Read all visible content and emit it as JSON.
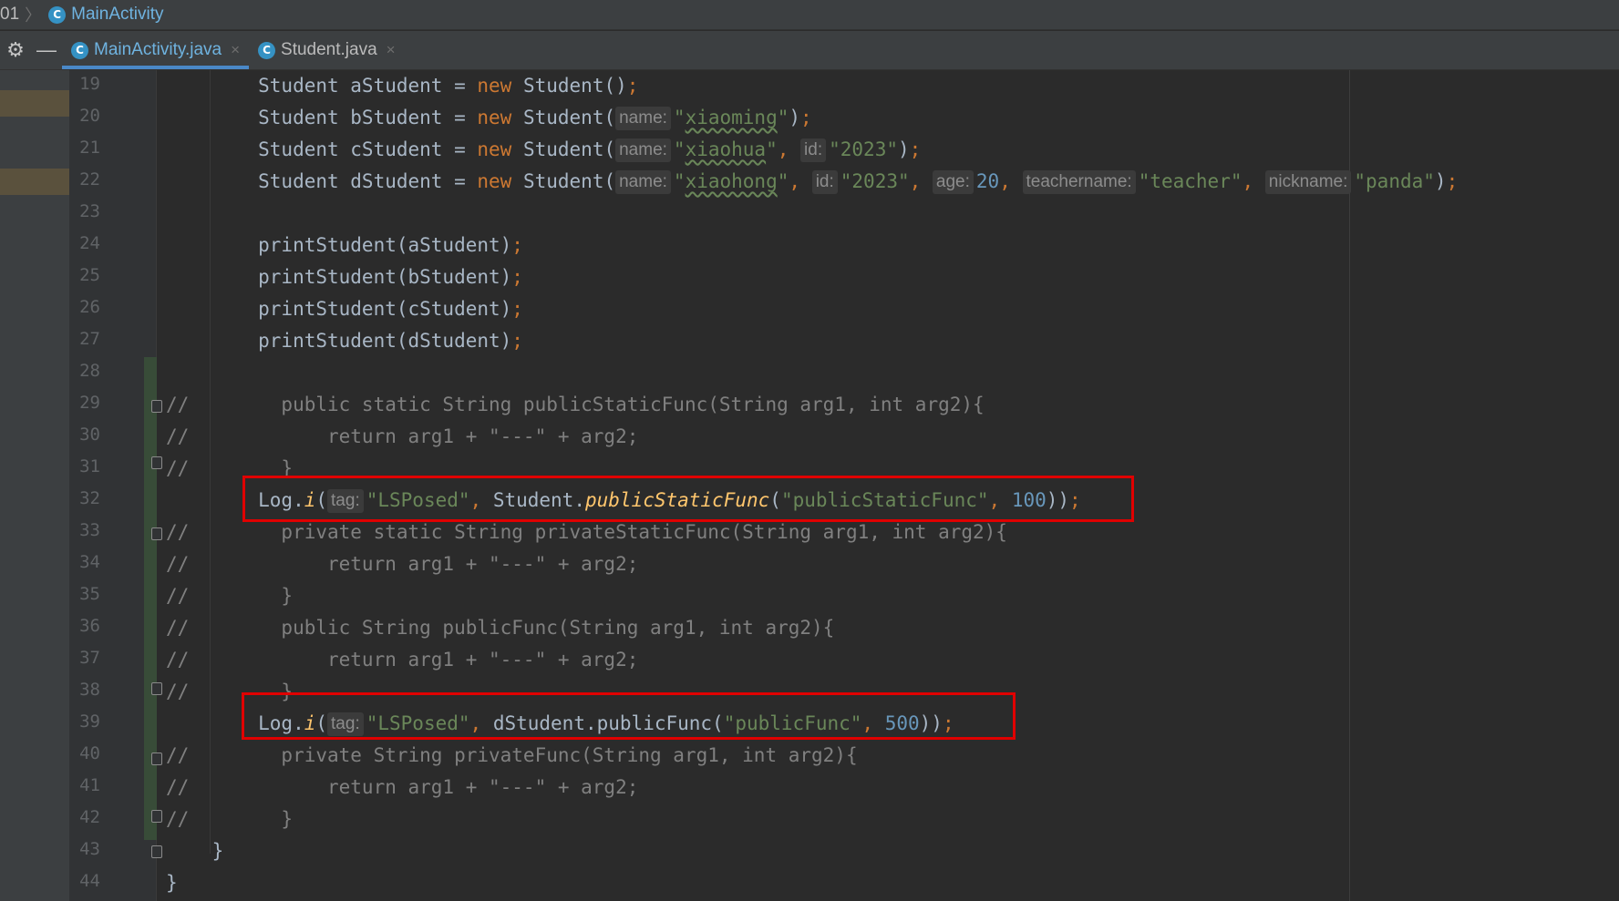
{
  "breadcrumb": {
    "prev": "01",
    "current": "MainActivity",
    "class_badge": "C"
  },
  "toolbar": {
    "settings_icon": "gear-icon",
    "minimize_icon": "minus-icon"
  },
  "tabs": [
    {
      "label": "MainActivity.java",
      "active": true
    },
    {
      "label": "Student.java",
      "active": false
    }
  ],
  "tab_close": "×",
  "colors": {
    "keyword": "#cc7832",
    "string": "#6a8759",
    "number": "#6897bb",
    "comment": "#808080",
    "highlight_box": "#e00000"
  },
  "lines": [
    {
      "n": "19",
      "segs": [
        [
          "plain",
          "        Student aStudent = "
        ],
        [
          "kw",
          "new"
        ],
        [
          "plain",
          " Student()"
        ],
        [
          "kw",
          ";"
        ]
      ]
    },
    {
      "n": "20",
      "segs": [
        [
          "plain",
          "        Student bStudent = "
        ],
        [
          "kw",
          "new"
        ],
        [
          "plain",
          " Student("
        ],
        [
          "hint",
          "name:"
        ],
        [
          "str",
          "\""
        ],
        [
          "typo",
          "xiaoming"
        ],
        [
          "str",
          "\""
        ],
        [
          "plain",
          ")"
        ],
        [
          "kw",
          ";"
        ]
      ]
    },
    {
      "n": "21",
      "segs": [
        [
          "plain",
          "        Student cStudent = "
        ],
        [
          "kw",
          "new"
        ],
        [
          "plain",
          " Student("
        ],
        [
          "hint",
          "name:"
        ],
        [
          "str",
          "\""
        ],
        [
          "typo",
          "xiaohua"
        ],
        [
          "str",
          "\""
        ],
        [
          "kw",
          ", "
        ],
        [
          "hint",
          "id:"
        ],
        [
          "str",
          "\"2023\""
        ],
        [
          "plain",
          ")"
        ],
        [
          "kw",
          ";"
        ]
      ]
    },
    {
      "n": "22",
      "segs": [
        [
          "plain",
          "        Student dStudent = "
        ],
        [
          "kw",
          "new"
        ],
        [
          "plain",
          " Student("
        ],
        [
          "hint",
          "name:"
        ],
        [
          "str",
          "\""
        ],
        [
          "typo",
          "xiaohong"
        ],
        [
          "str",
          "\""
        ],
        [
          "kw",
          ", "
        ],
        [
          "hint",
          "id:"
        ],
        [
          "str",
          "\"2023\""
        ],
        [
          "kw",
          ", "
        ],
        [
          "hint",
          "age:"
        ],
        [
          "num",
          "20"
        ],
        [
          "kw",
          ", "
        ],
        [
          "hint",
          "teachername:"
        ],
        [
          "str",
          "\"teacher\""
        ],
        [
          "kw",
          ", "
        ],
        [
          "hint",
          "nickname:"
        ],
        [
          "str",
          "\"panda\""
        ],
        [
          "plain",
          ")"
        ],
        [
          "kw",
          ";"
        ]
      ]
    },
    {
      "n": "23",
      "segs": []
    },
    {
      "n": "24",
      "segs": [
        [
          "plain",
          "        printStudent(aStudent)"
        ],
        [
          "kw",
          ";"
        ]
      ]
    },
    {
      "n": "25",
      "segs": [
        [
          "plain",
          "        printStudent(bStudent)"
        ],
        [
          "kw",
          ";"
        ]
      ]
    },
    {
      "n": "26",
      "segs": [
        [
          "plain",
          "        printStudent(cStudent)"
        ],
        [
          "kw",
          ";"
        ]
      ]
    },
    {
      "n": "27",
      "segs": [
        [
          "plain",
          "        printStudent(dStudent)"
        ],
        [
          "kw",
          ";"
        ]
      ]
    },
    {
      "n": "28",
      "segs": []
    },
    {
      "n": "29",
      "segs": [
        [
          "cm",
          "//        public static String publicStaticFunc(String arg1, int arg2){"
        ]
      ]
    },
    {
      "n": "30",
      "segs": [
        [
          "cm",
          "//            return arg1 + \"---\" + arg2;"
        ]
      ]
    },
    {
      "n": "31",
      "segs": [
        [
          "cm",
          "//        }"
        ]
      ]
    },
    {
      "n": "32",
      "segs": [
        [
          "plain",
          "        Log."
        ],
        [
          "ital",
          "i"
        ],
        [
          "plain",
          "("
        ],
        [
          "hint",
          "tag:"
        ],
        [
          "str",
          "\"LSPosed\""
        ],
        [
          "kw",
          ", "
        ],
        [
          "plain",
          "Student."
        ],
        [
          "ital",
          "publicStaticFunc"
        ],
        [
          "plain",
          "("
        ],
        [
          "str",
          "\"publicStaticFunc\""
        ],
        [
          "kw",
          ", "
        ],
        [
          "num",
          "100"
        ],
        [
          "plain",
          "))"
        ],
        [
          "kw",
          ";"
        ]
      ]
    },
    {
      "n": "33",
      "segs": [
        [
          "cm",
          "//        private static String privateStaticFunc(String arg1, int arg2){"
        ]
      ]
    },
    {
      "n": "34",
      "segs": [
        [
          "cm",
          "//            return arg1 + \"---\" + arg2;"
        ]
      ]
    },
    {
      "n": "35",
      "segs": [
        [
          "cm",
          "//        }"
        ]
      ]
    },
    {
      "n": "36",
      "segs": [
        [
          "cm",
          "//        public String publicFunc(String arg1, int arg2){"
        ]
      ]
    },
    {
      "n": "37",
      "segs": [
        [
          "cm",
          "//            return arg1 + \"---\" + arg2;"
        ]
      ]
    },
    {
      "n": "38",
      "segs": [
        [
          "cm",
          "//        }"
        ]
      ]
    },
    {
      "n": "39",
      "segs": [
        [
          "plain",
          "        Log."
        ],
        [
          "ital",
          "i"
        ],
        [
          "plain",
          "("
        ],
        [
          "hint",
          "tag:"
        ],
        [
          "str",
          "\"LSPosed\""
        ],
        [
          "kw",
          ", "
        ],
        [
          "plain",
          "dStudent.publicFunc("
        ],
        [
          "str",
          "\"publicFunc\""
        ],
        [
          "kw",
          ", "
        ],
        [
          "num",
          "500"
        ],
        [
          "plain",
          "))"
        ],
        [
          "kw",
          ";"
        ]
      ]
    },
    {
      "n": "40",
      "segs": [
        [
          "cm",
          "//        private String privateFunc(String arg1, int arg2){"
        ]
      ]
    },
    {
      "n": "41",
      "segs": [
        [
          "cm",
          "//            return arg1 + \"---\" + arg2;"
        ]
      ]
    },
    {
      "n": "42",
      "segs": [
        [
          "cm",
          "//        }"
        ]
      ]
    },
    {
      "n": "43",
      "segs": [
        [
          "plain",
          "    }"
        ]
      ]
    },
    {
      "n": "44",
      "segs": [
        [
          "plain",
          "}"
        ]
      ]
    }
  ]
}
